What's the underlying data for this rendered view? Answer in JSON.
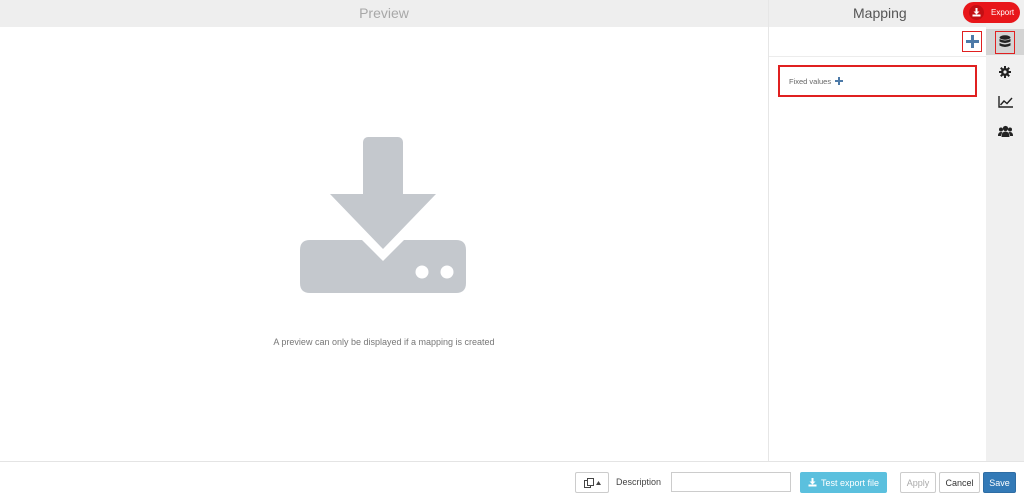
{
  "preview": {
    "title": "Preview",
    "empty_message": "A preview can only be displayed if a mapping is created"
  },
  "mapping": {
    "title": "Mapping",
    "fixed_values_label": "Fixed values"
  },
  "header": {
    "export_label": "Export"
  },
  "sidebar": {
    "icons": [
      "database-icon",
      "gear-icon",
      "line-chart-icon",
      "users-icon"
    ],
    "active": "database-icon"
  },
  "footer": {
    "description_label": "Description",
    "description_value": "",
    "test_export_label": "Test export file",
    "apply_label": "Apply",
    "cancel_label": "Cancel",
    "save_label": "Save"
  },
  "colors": {
    "accent_red": "#e8161a",
    "highlight_border": "#e02020",
    "primary_blue": "#337ab7",
    "info_blue": "#5bc0de",
    "illustration_gray": "#c4c8cd",
    "plus_blue": "#4d7aa8"
  }
}
